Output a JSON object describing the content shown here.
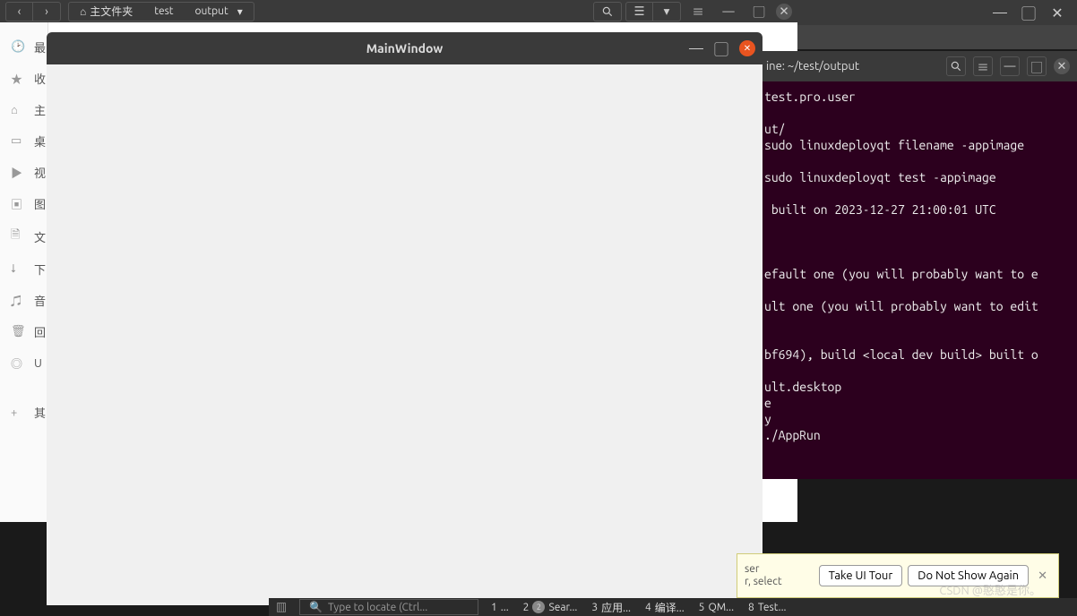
{
  "filemanager": {
    "breadcrumb_home": "主文件夹",
    "breadcrumb": [
      "test",
      "output"
    ],
    "sidebar": [
      {
        "icon": "clock",
        "label": "最"
      },
      {
        "icon": "star",
        "label": "收"
      },
      {
        "icon": "home",
        "label": "主"
      },
      {
        "icon": "desktop",
        "label": "桌"
      },
      {
        "icon": "video",
        "label": "视"
      },
      {
        "icon": "image",
        "label": "图"
      },
      {
        "icon": "doc",
        "label": "文"
      },
      {
        "icon": "download",
        "label": "下"
      },
      {
        "icon": "music",
        "label": "音"
      },
      {
        "icon": "trash",
        "label": "回"
      },
      {
        "icon": "disc",
        "label": "U"
      },
      {
        "icon": "plus",
        "label": "其"
      }
    ]
  },
  "qt_window": {
    "title": "MainWindow"
  },
  "terminal": {
    "title": "ine: ~/test/output",
    "lines": [
      "test.pro.user",
      "",
      "ut/",
      "sudo linuxdeployqt filename -appimage",
      "",
      "sudo linuxdeployqt test -appimage",
      "",
      " built on 2023-12-27 21:00:01 UTC",
      "",
      "",
      "",
      "efault one (you will probably want to e",
      "",
      "ult one (you will probably want to edit",
      "",
      "",
      "bf694), build <local dev build> built o",
      "",
      "ult.desktop",
      "e",
      "y",
      "./AppRun"
    ]
  },
  "tour": {
    "text_line1": "ser",
    "text_line2": "r, select",
    "take_tour": "Take UI Tour",
    "dont_show": "Do Not Show Again"
  },
  "taskbar": {
    "locator_placeholder": "Type to locate (Ctrl...",
    "items": [
      {
        "num": "1",
        "label": "..."
      },
      {
        "num": "2",
        "label": "Sear...",
        "badge": "2"
      },
      {
        "num": "3",
        "label": "应用..."
      },
      {
        "num": "4",
        "label": "编译..."
      },
      {
        "num": "5",
        "label": "QM..."
      },
      {
        "num": "8",
        "label": "Test..."
      }
    ]
  },
  "watermark": "CSDN @憨憨是你。"
}
